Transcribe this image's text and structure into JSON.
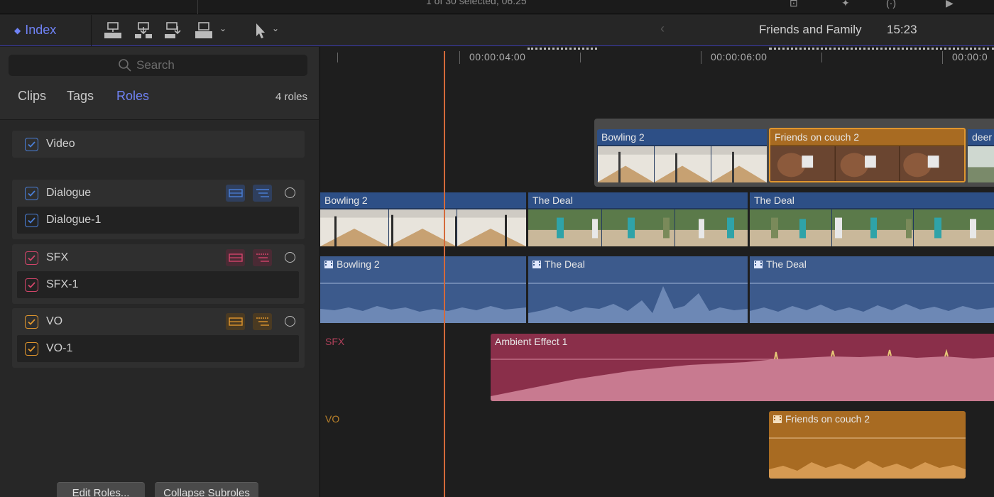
{
  "topbar": {
    "selection_status": "1 of 30 selected, 06:25"
  },
  "toolbar": {
    "index_label": "Index",
    "project_title": "Friends and Family",
    "project_duration": "15:23"
  },
  "browser": {
    "search_placeholder": "Search",
    "tabs": [
      {
        "label": "Clips",
        "active": false
      },
      {
        "label": "Tags",
        "active": false
      },
      {
        "label": "Roles",
        "active": true
      }
    ],
    "role_count": "4 roles",
    "roles": [
      {
        "name": "Video",
        "color": "#4a7fd8",
        "subroles": []
      },
      {
        "name": "Dialogue",
        "color": "#4a7fd8",
        "subroles": [
          "Dialogue-1"
        ]
      },
      {
        "name": "SFX",
        "color": "#d2456a",
        "subroles": [
          "SFX-1"
        ]
      },
      {
        "name": "VO",
        "color": "#e0962e",
        "subroles": [
          "VO-1"
        ]
      }
    ],
    "edit_roles_label": "Edit Roles...",
    "collapse_subroles_label": "Collapse Subroles"
  },
  "timeline": {
    "timecodes": [
      "00:00:04:00",
      "00:00:06:00",
      "00:00:0"
    ],
    "connected_clips": [
      {
        "name": "Bowling 2"
      },
      {
        "name": "Friends on couch 2"
      },
      {
        "name": "deer"
      }
    ],
    "primary_clips": [
      {
        "name": "Bowling 2"
      },
      {
        "name": "The Deal"
      },
      {
        "name": "The Deal"
      }
    ],
    "dialogue_audio": [
      {
        "name": "Bowling 2"
      },
      {
        "name": "The Deal"
      },
      {
        "name": "The Deal"
      }
    ],
    "sfx_lane_label": "SFX",
    "sfx_clip": "Ambient Effect 1",
    "vo_lane_label": "VO",
    "vo_clip": "Friends on couch 2"
  },
  "colors": {
    "accent": "#6f82f5",
    "video": "#4a7fd8",
    "sfx": "#d2456a",
    "vo": "#e0962e",
    "playhead": "#d46a3a"
  }
}
